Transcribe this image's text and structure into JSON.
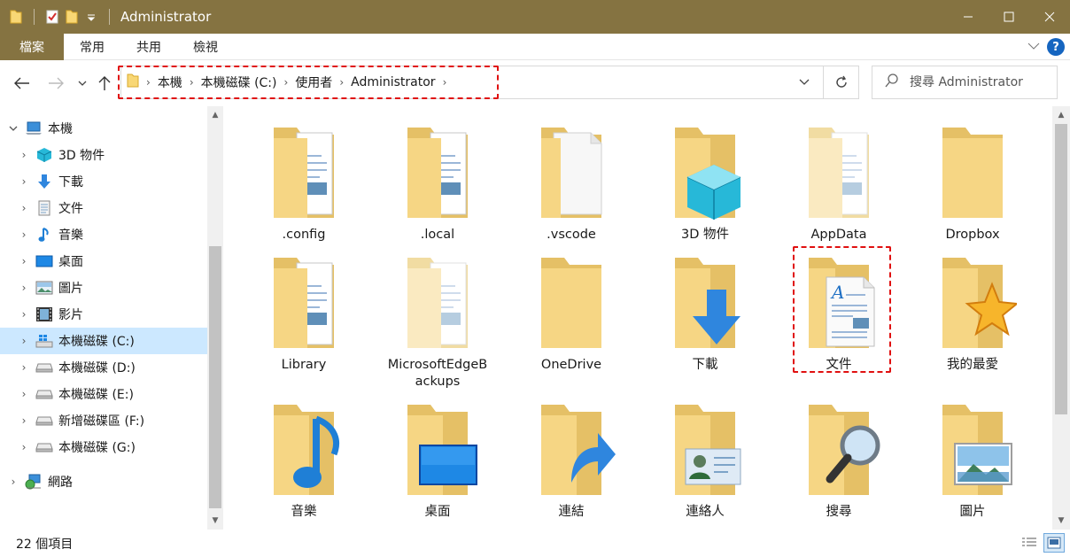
{
  "window": {
    "title": "Administrator",
    "accent_color": "#857341"
  },
  "ribbon": {
    "tabs": [
      "檔案",
      "常用",
      "共用",
      "檢視"
    ],
    "help_label": "?"
  },
  "address": {
    "crumbs": [
      "本機",
      "本機磁碟 (C:)",
      "使用者",
      "Administrator"
    ]
  },
  "search": {
    "placeholder": "搜尋 Administrator"
  },
  "nav": {
    "items": [
      {
        "label": "本機",
        "icon": "computer-icon"
      },
      {
        "label": "3D 物件",
        "icon": "cube-icon"
      },
      {
        "label": "下載",
        "icon": "download-arrow-icon"
      },
      {
        "label": "文件",
        "icon": "document-icon"
      },
      {
        "label": "音樂",
        "icon": "music-note-icon"
      },
      {
        "label": "桌面",
        "icon": "desktop-icon"
      },
      {
        "label": "圖片",
        "icon": "picture-icon"
      },
      {
        "label": "影片",
        "icon": "film-icon"
      },
      {
        "label": "本機磁碟 (C:)",
        "icon": "windows-drive-icon",
        "selected": true
      },
      {
        "label": "本機磁碟 (D:)",
        "icon": "drive-icon"
      },
      {
        "label": "本機磁碟 (E:)",
        "icon": "drive-icon"
      },
      {
        "label": "新增磁碟區 (F:)",
        "icon": "drive-icon"
      },
      {
        "label": "本機磁碟 (G:)",
        "icon": "drive-icon"
      },
      {
        "label": "網路",
        "icon": "network-icon"
      }
    ]
  },
  "files": [
    {
      "label": ".config",
      "overlay": "papers"
    },
    {
      "label": ".local",
      "overlay": "papers"
    },
    {
      "label": ".vscode",
      "overlay": "file"
    },
    {
      "label": "3D 物件",
      "overlay": "cube"
    },
    {
      "label": "AppData",
      "overlay": "faded"
    },
    {
      "label": "Dropbox",
      "overlay": "none"
    },
    {
      "label": "Library",
      "overlay": "papers"
    },
    {
      "label": "MicrosoftEdgeBackups",
      "overlay": "faded"
    },
    {
      "label": "OneDrive",
      "overlay": "none"
    },
    {
      "label": "下載",
      "overlay": "download"
    },
    {
      "label": "文件",
      "overlay": "document"
    },
    {
      "label": "我的最愛",
      "overlay": "star"
    },
    {
      "label": "音樂",
      "overlay": "music"
    },
    {
      "label": "桌面",
      "overlay": "desktop"
    },
    {
      "label": "連結",
      "overlay": "link"
    },
    {
      "label": "連絡人",
      "overlay": "contact"
    },
    {
      "label": "搜尋",
      "overlay": "search"
    },
    {
      "label": "圖片",
      "overlay": "picture"
    }
  ],
  "status": {
    "item_count": "22 個項目"
  }
}
